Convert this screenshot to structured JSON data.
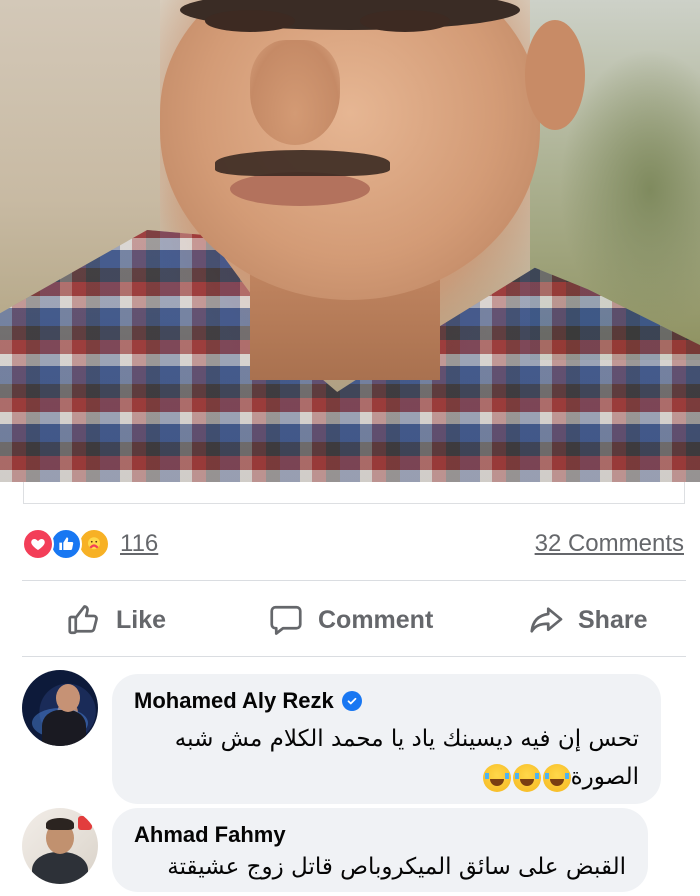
{
  "post": {
    "photo_alt": "Vintage portrait photo of a young man with a mustache wearing a plaid shirt",
    "reactions": {
      "icons": [
        "love-icon",
        "like-icon",
        "care-icon"
      ],
      "count": "116"
    },
    "comments_count": "32 Comments"
  },
  "actions": {
    "like": "Like",
    "comment": "Comment",
    "share": "Share"
  },
  "comments": [
    {
      "author": "Mohamed Aly Rezk",
      "verified": true,
      "text_line1": "تحس إن فيه ديسينك ياد يا محمد الكلام مش شبه",
      "text_line2": "الصورة",
      "emoji": [
        "face-with-tears-of-joy-icon",
        "face-with-tears-of-joy-icon",
        "face-with-tears-of-joy-icon"
      ]
    },
    {
      "author": "Ahmad Fahmy",
      "verified": false,
      "text": "القبض على سائق الميكروباص قاتل زوج عشيقتة"
    }
  ],
  "colors": {
    "accent": "#1877f2",
    "love": "#f33e58",
    "care": "#f7b125",
    "muted_text": "#65676b",
    "bubble": "#f0f2f5"
  }
}
